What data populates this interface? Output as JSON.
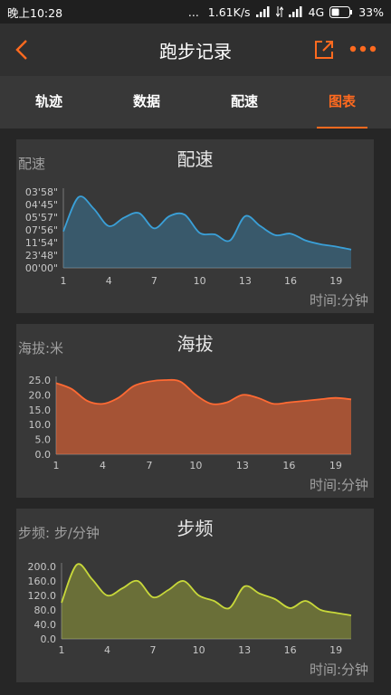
{
  "status_bar": {
    "time": "晚上10:28",
    "dots": "...",
    "speed": "1.61K/s",
    "network": "4G",
    "battery": "33%"
  },
  "app_bar": {
    "title": "跑步记录"
  },
  "tabs": [
    {
      "label": "轨迹",
      "active": false
    },
    {
      "label": "数据",
      "active": false
    },
    {
      "label": "配速",
      "active": false
    },
    {
      "label": "图表",
      "active": true
    }
  ],
  "colors": {
    "accent": "#ff6a1f",
    "pace": "#3aa0d8",
    "elevation": "#ff6a33",
    "cadence": "#c8d83a"
  },
  "icons": [
    "back-arrow-icon",
    "share-icon",
    "more-icon",
    "signal-icon",
    "battery-icon"
  ],
  "charts": [
    {
      "title": "配速",
      "ylabel": "配速",
      "xlabel": "时间:分钟",
      "yticks": [
        "03'58\"",
        "04'45\"",
        "05'57\"",
        "07'56\"",
        "11'54\"",
        "23'48\"",
        "00'00\""
      ],
      "xticks": [
        "1",
        "4",
        "7",
        "10",
        "13",
        "16",
        "19"
      ]
    },
    {
      "title": "海拔",
      "ylabel": "海拔:米",
      "xlabel": "时间:分钟",
      "yticks": [
        "25.0",
        "20.0",
        "15.0",
        "10.0",
        "5.0",
        "0.0"
      ],
      "xticks": [
        "1",
        "4",
        "7",
        "10",
        "13",
        "16",
        "19"
      ]
    },
    {
      "title": "步频",
      "ylabel": "步频: 步/分钟",
      "xlabel": "时间:分钟",
      "yticks": [
        "200.0",
        "160.0",
        "120.0",
        "80.0",
        "40.0",
        "0.0"
      ],
      "xticks": [
        "1",
        "4",
        "7",
        "10",
        "13",
        "16",
        "19"
      ]
    }
  ],
  "chart_data": [
    {
      "type": "area",
      "title": "配速",
      "series": [
        {
          "values_level": [
            0.48,
            0.93,
            0.78,
            0.55,
            0.66,
            0.72,
            0.52,
            0.68,
            0.7,
            0.46,
            0.44,
            0.36,
            0.68,
            0.55,
            0.43,
            0.45,
            0.36,
            0.31,
            0.28,
            0.24
          ]
        }
      ],
      "x": [
        1,
        2,
        3,
        4,
        5,
        6,
        7,
        8,
        9,
        10,
        11,
        12,
        13,
        14,
        15,
        16,
        17,
        18,
        19,
        20
      ],
      "xlim": [
        1,
        20
      ]
    },
    {
      "type": "area",
      "title": "海拔",
      "series": [
        {
          "values": [
            24.0,
            22.0,
            18.0,
            17.0,
            19.0,
            23.0,
            24.5,
            25.0,
            24.5,
            20.0,
            17.0,
            17.5,
            20.0,
            19.0,
            17.0,
            17.5,
            18.0,
            18.5,
            19.0,
            18.5
          ]
        }
      ],
      "x": [
        1,
        2,
        3,
        4,
        5,
        6,
        7,
        8,
        9,
        10,
        11,
        12,
        13,
        14,
        15,
        16,
        17,
        18,
        19,
        20
      ],
      "ylim": [
        0,
        25
      ],
      "xlim": [
        1,
        20
      ]
    },
    {
      "type": "area",
      "title": "步频",
      "series": [
        {
          "values": [
            100,
            205,
            165,
            120,
            140,
            160,
            115,
            135,
            160,
            120,
            105,
            85,
            145,
            125,
            110,
            85,
            105,
            80,
            72,
            65
          ]
        }
      ],
      "x": [
        1,
        2,
        3,
        4,
        5,
        6,
        7,
        8,
        9,
        10,
        11,
        12,
        13,
        14,
        15,
        16,
        17,
        18,
        19,
        20
      ],
      "ylim": [
        0,
        200
      ],
      "xlim": [
        1,
        20
      ]
    }
  ]
}
